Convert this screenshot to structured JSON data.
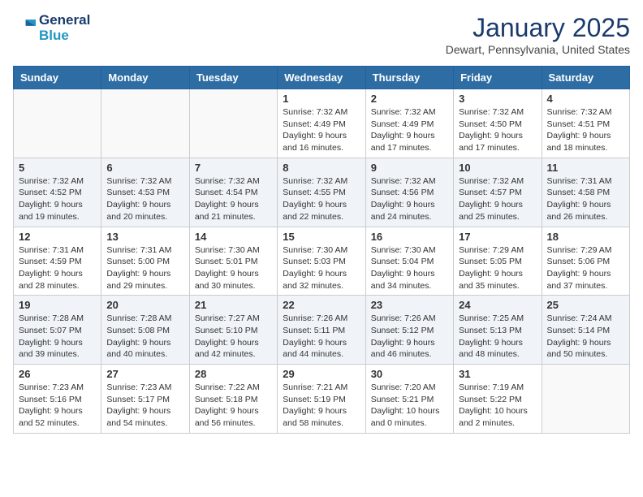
{
  "header": {
    "logo_line1": "General",
    "logo_line2": "Blue",
    "month": "January 2025",
    "location": "Dewart, Pennsylvania, United States"
  },
  "weekdays": [
    "Sunday",
    "Monday",
    "Tuesday",
    "Wednesday",
    "Thursday",
    "Friday",
    "Saturday"
  ],
  "weeks": [
    [
      {
        "day": "",
        "info": ""
      },
      {
        "day": "",
        "info": ""
      },
      {
        "day": "",
        "info": ""
      },
      {
        "day": "1",
        "info": "Sunrise: 7:32 AM\nSunset: 4:49 PM\nDaylight: 9 hours\nand 16 minutes."
      },
      {
        "day": "2",
        "info": "Sunrise: 7:32 AM\nSunset: 4:49 PM\nDaylight: 9 hours\nand 17 minutes."
      },
      {
        "day": "3",
        "info": "Sunrise: 7:32 AM\nSunset: 4:50 PM\nDaylight: 9 hours\nand 17 minutes."
      },
      {
        "day": "4",
        "info": "Sunrise: 7:32 AM\nSunset: 4:51 PM\nDaylight: 9 hours\nand 18 minutes."
      }
    ],
    [
      {
        "day": "5",
        "info": "Sunrise: 7:32 AM\nSunset: 4:52 PM\nDaylight: 9 hours\nand 19 minutes."
      },
      {
        "day": "6",
        "info": "Sunrise: 7:32 AM\nSunset: 4:53 PM\nDaylight: 9 hours\nand 20 minutes."
      },
      {
        "day": "7",
        "info": "Sunrise: 7:32 AM\nSunset: 4:54 PM\nDaylight: 9 hours\nand 21 minutes."
      },
      {
        "day": "8",
        "info": "Sunrise: 7:32 AM\nSunset: 4:55 PM\nDaylight: 9 hours\nand 22 minutes."
      },
      {
        "day": "9",
        "info": "Sunrise: 7:32 AM\nSunset: 4:56 PM\nDaylight: 9 hours\nand 24 minutes."
      },
      {
        "day": "10",
        "info": "Sunrise: 7:32 AM\nSunset: 4:57 PM\nDaylight: 9 hours\nand 25 minutes."
      },
      {
        "day": "11",
        "info": "Sunrise: 7:31 AM\nSunset: 4:58 PM\nDaylight: 9 hours\nand 26 minutes."
      }
    ],
    [
      {
        "day": "12",
        "info": "Sunrise: 7:31 AM\nSunset: 4:59 PM\nDaylight: 9 hours\nand 28 minutes."
      },
      {
        "day": "13",
        "info": "Sunrise: 7:31 AM\nSunset: 5:00 PM\nDaylight: 9 hours\nand 29 minutes."
      },
      {
        "day": "14",
        "info": "Sunrise: 7:30 AM\nSunset: 5:01 PM\nDaylight: 9 hours\nand 30 minutes."
      },
      {
        "day": "15",
        "info": "Sunrise: 7:30 AM\nSunset: 5:03 PM\nDaylight: 9 hours\nand 32 minutes."
      },
      {
        "day": "16",
        "info": "Sunrise: 7:30 AM\nSunset: 5:04 PM\nDaylight: 9 hours\nand 34 minutes."
      },
      {
        "day": "17",
        "info": "Sunrise: 7:29 AM\nSunset: 5:05 PM\nDaylight: 9 hours\nand 35 minutes."
      },
      {
        "day": "18",
        "info": "Sunrise: 7:29 AM\nSunset: 5:06 PM\nDaylight: 9 hours\nand 37 minutes."
      }
    ],
    [
      {
        "day": "19",
        "info": "Sunrise: 7:28 AM\nSunset: 5:07 PM\nDaylight: 9 hours\nand 39 minutes."
      },
      {
        "day": "20",
        "info": "Sunrise: 7:28 AM\nSunset: 5:08 PM\nDaylight: 9 hours\nand 40 minutes."
      },
      {
        "day": "21",
        "info": "Sunrise: 7:27 AM\nSunset: 5:10 PM\nDaylight: 9 hours\nand 42 minutes."
      },
      {
        "day": "22",
        "info": "Sunrise: 7:26 AM\nSunset: 5:11 PM\nDaylight: 9 hours\nand 44 minutes."
      },
      {
        "day": "23",
        "info": "Sunrise: 7:26 AM\nSunset: 5:12 PM\nDaylight: 9 hours\nand 46 minutes."
      },
      {
        "day": "24",
        "info": "Sunrise: 7:25 AM\nSunset: 5:13 PM\nDaylight: 9 hours\nand 48 minutes."
      },
      {
        "day": "25",
        "info": "Sunrise: 7:24 AM\nSunset: 5:14 PM\nDaylight: 9 hours\nand 50 minutes."
      }
    ],
    [
      {
        "day": "26",
        "info": "Sunrise: 7:23 AM\nSunset: 5:16 PM\nDaylight: 9 hours\nand 52 minutes."
      },
      {
        "day": "27",
        "info": "Sunrise: 7:23 AM\nSunset: 5:17 PM\nDaylight: 9 hours\nand 54 minutes."
      },
      {
        "day": "28",
        "info": "Sunrise: 7:22 AM\nSunset: 5:18 PM\nDaylight: 9 hours\nand 56 minutes."
      },
      {
        "day": "29",
        "info": "Sunrise: 7:21 AM\nSunset: 5:19 PM\nDaylight: 9 hours\nand 58 minutes."
      },
      {
        "day": "30",
        "info": "Sunrise: 7:20 AM\nSunset: 5:21 PM\nDaylight: 10 hours\nand 0 minutes."
      },
      {
        "day": "31",
        "info": "Sunrise: 7:19 AM\nSunset: 5:22 PM\nDaylight: 10 hours\nand 2 minutes."
      },
      {
        "day": "",
        "info": ""
      }
    ]
  ]
}
